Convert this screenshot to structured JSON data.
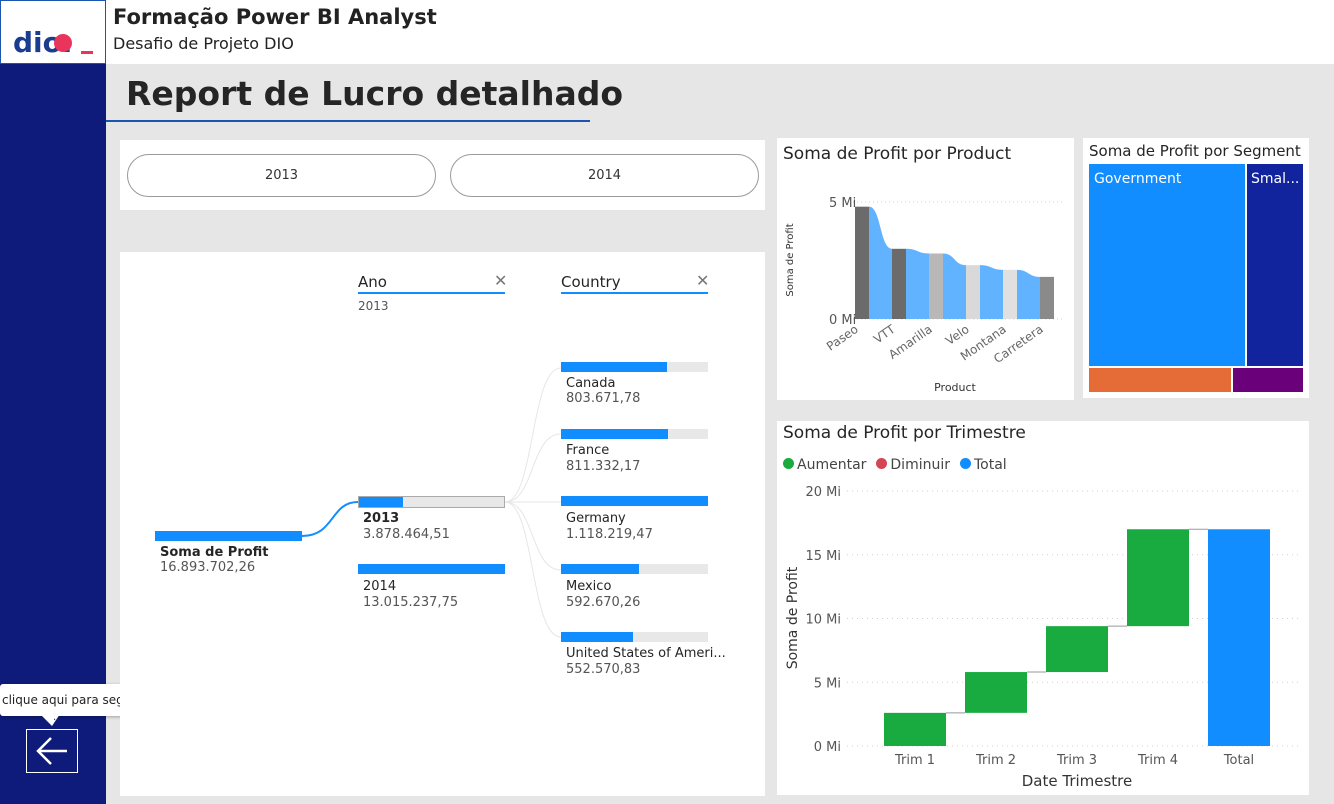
{
  "header": {
    "title": "Formação Power BI Analyst",
    "subtitle": "Desafio de Projeto DIO"
  },
  "report_title": "Report de Lucro detalhado",
  "logo_text": "dio.",
  "back_button": {
    "icon": "arrow-left-icon",
    "tooltip": "clique aqui para seguir link"
  },
  "year_slicer": {
    "options": [
      "2013",
      "2014"
    ]
  },
  "decomposition": {
    "levels": [
      {
        "header": "Ano",
        "selected": "2013"
      },
      {
        "header": "Country",
        "selected": ""
      }
    ],
    "root": {
      "label": "Soma de Profit",
      "value": "16.893.702,26"
    },
    "years": [
      {
        "label": "2013",
        "value": "3.878.464,51",
        "fill": 0.3
      },
      {
        "label": "2014",
        "value": "13.015.237,75",
        "fill": 1.0
      }
    ],
    "countries": [
      {
        "label": "Canada",
        "value": "803.671,78",
        "fill": 0.72
      },
      {
        "label": "France",
        "value": "811.332,17",
        "fill": 0.73
      },
      {
        "label": "Germany",
        "value": "1.118.219,47",
        "fill": 1.0
      },
      {
        "label": "Mexico",
        "value": "592.670,26",
        "fill": 0.53
      },
      {
        "label": "United States of Ameri...",
        "value": "552.570,83",
        "fill": 0.49
      }
    ],
    "colors": {
      "bar": "#118dff",
      "track": "#e8e8e8"
    }
  },
  "chart_data": [
    {
      "type": "bar",
      "title": "Soma de Profit por Product",
      "xlabel": "Product",
      "ylabel": "Soma de Profit",
      "categories": [
        "Paseo",
        "VTT",
        "Amarilla",
        "Velo",
        "Montana",
        "Carretera"
      ],
      "values": [
        4.8,
        3.0,
        2.8,
        2.3,
        2.1,
        1.8
      ],
      "yticks": [
        "0 Mi",
        "5 Mi"
      ],
      "ylim": [
        0,
        5
      ],
      "colors": [
        "#6b6b6b",
        "#61b2ff",
        "#6b6b6b",
        "#61b2ff",
        "#b8b8b8",
        "#61b2ff",
        "#d9d9d9",
        "#61b2ff",
        "#e0e0e0",
        "#61b2ff",
        "#8a8a8a"
      ]
    },
    {
      "type": "treemap",
      "title": "Soma de Profit por Segment",
      "items": [
        {
          "name": "Government",
          "color": "#118dff"
        },
        {
          "name": "Smal...",
          "color": "#12239e"
        },
        {
          "name": "",
          "color": "#e66c37"
        },
        {
          "name": "",
          "color": "#6b007b"
        }
      ]
    },
    {
      "type": "waterfall",
      "title": "Soma de Profit por Trimestre",
      "xlabel": "Date Trimestre",
      "ylabel": "Soma de Profit",
      "legend": [
        {
          "name": "Aumentar",
          "color": "#1aab40"
        },
        {
          "name": "Diminuir",
          "color": "#d64554"
        },
        {
          "name": "Total",
          "color": "#118dff"
        }
      ],
      "categories": [
        "Trim 1",
        "Trim 2",
        "Trim 3",
        "Trim 4",
        "Total"
      ],
      "values": [
        2.6,
        3.2,
        3.6,
        7.6,
        17.0
      ],
      "yticks": [
        "0 Mi",
        "5 Mi",
        "10 Mi",
        "15 Mi",
        "20 Mi"
      ],
      "ylim": [
        0,
        20
      ]
    }
  ]
}
